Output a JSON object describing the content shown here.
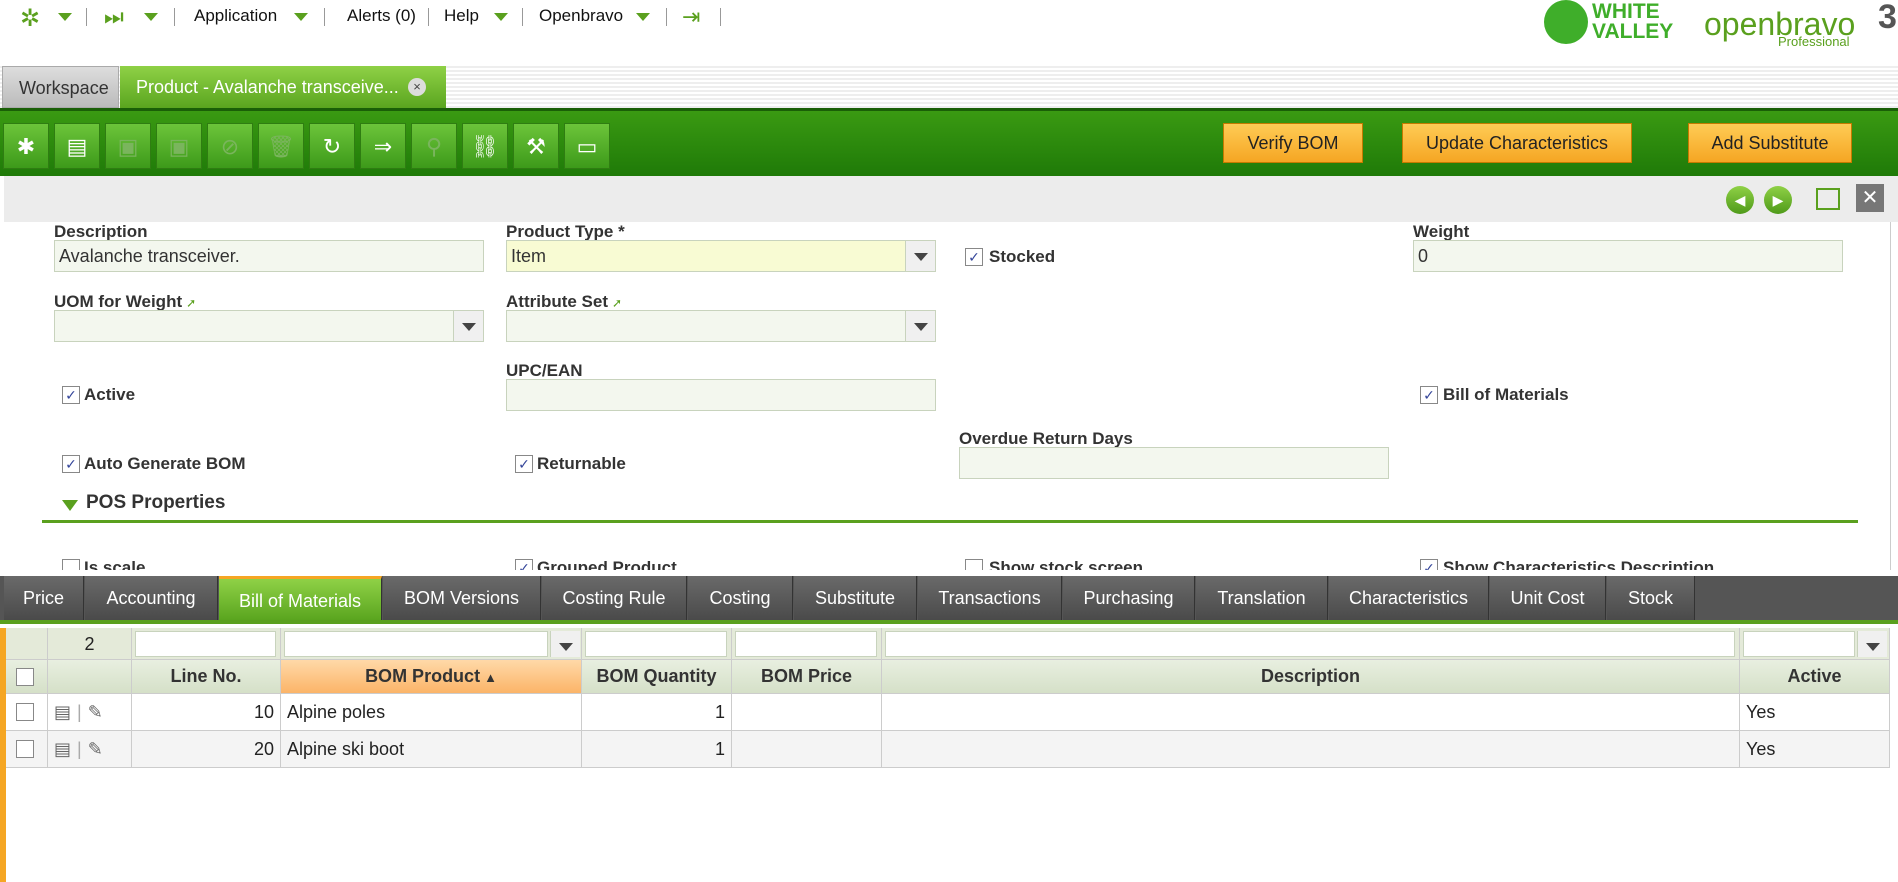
{
  "topnav": {
    "application": "Application",
    "alerts": "Alerts (0)",
    "help": "Help",
    "openbravo": "Openbravo"
  },
  "logos": {
    "whitevalley_line1": "WHITE",
    "whitevalley_line2": "VALLEY",
    "openbravo": "openbravo",
    "openbravo_edition": "Professional",
    "version_digit": "3"
  },
  "window_tabs": {
    "workspace": "Workspace",
    "product": "Product - Avalanche transceive...",
    "close": "×"
  },
  "toolbar": {
    "verify_bom": "Verify BOM",
    "update_characteristics": "Update Characteristics",
    "add_substitute": "Add Substitute"
  },
  "form": {
    "description_label": "Description",
    "description_value": "Avalanche transceiver.",
    "product_type_label": "Product Type *",
    "product_type_value": "Item",
    "stocked_label": "Stocked",
    "weight_label": "Weight",
    "weight_value": "0",
    "uom_weight_label": "UOM for Weight",
    "attribute_set_label": "Attribute Set",
    "upc_label": "UPC/EAN",
    "active_label": "Active",
    "bom_label": "Bill of Materials",
    "overdue_label": "Overdue Return Days",
    "auto_bom_label": "Auto Generate BOM",
    "returnable_label": "Returnable",
    "pos_section": "POS Properties",
    "is_scale_label": "Is scale",
    "grouped_label": "Grouped Product",
    "show_stock_label": "Show stock screen",
    "show_char_label": "Show Characteristics Description"
  },
  "subtabs": [
    "Price",
    "Accounting",
    "Bill of Materials",
    "BOM Versions",
    "Costing Rule",
    "Costing",
    "Substitute",
    "Transactions",
    "Purchasing",
    "Translation",
    "Characteristics",
    "Unit Cost",
    "Stock"
  ],
  "grid": {
    "count": "2",
    "headers": {
      "line_no": "Line No.",
      "bom_product": "BOM Product",
      "bom_quantity": "BOM Quantity",
      "bom_price": "BOM Price",
      "description": "Description",
      "active": "Active"
    },
    "rows": [
      {
        "line_no": "10",
        "bom_product": "Alpine poles",
        "bom_quantity": "1",
        "bom_price": "",
        "description": "",
        "active": "Yes"
      },
      {
        "line_no": "20",
        "bom_product": "Alpine ski boot",
        "bom_quantity": "1",
        "bom_price": "",
        "description": "",
        "active": "Yes"
      }
    ]
  },
  "colors": {
    "brand_green": "#5aa01e",
    "orange_button": "#f5a623",
    "dark_tab": "#4a4a4a"
  }
}
